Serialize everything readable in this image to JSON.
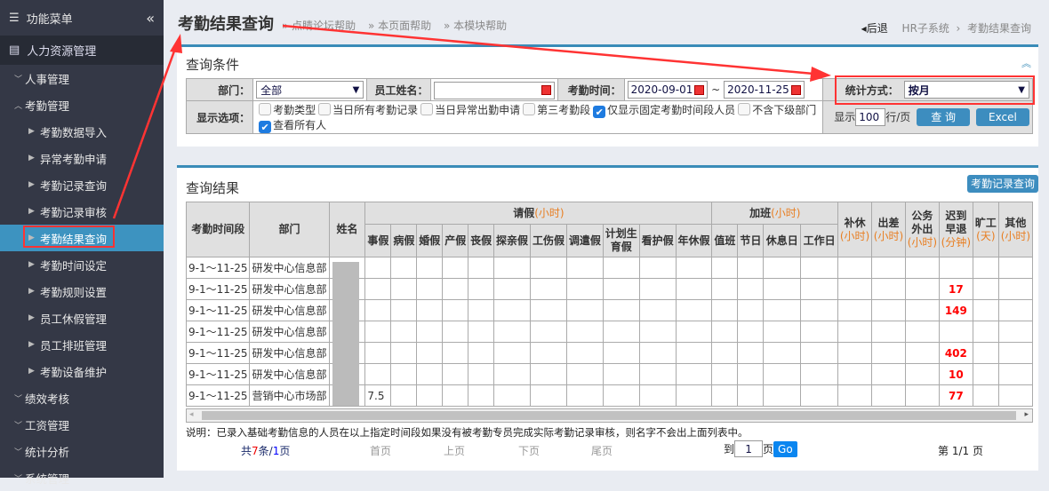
{
  "sidebar": {
    "title": "功能菜单",
    "collapse_icon": "double-chevron-left",
    "module": "人力资源管理",
    "groups": [
      {
        "label": "人事管理"
      },
      {
        "label": "考勤管理"
      }
    ],
    "sub_items": [
      "考勤数据导入",
      "异常考勤申请",
      "考勤记录查询",
      "考勤记录审核",
      "考勤结果查询",
      "考勤时间设定",
      "考勤规则设置",
      "员工休假管理",
      "员工排班管理",
      "考勤设备维护"
    ],
    "active": "考勤结果查询",
    "more_groups": [
      "绩效考核",
      "工资管理",
      "统计分析",
      "系统管理"
    ]
  },
  "header": {
    "title": "考勤结果查询",
    "helps": [
      "» 点睛论坛帮助",
      "» 本页面帮助",
      "» 本模块帮助"
    ],
    "back": "后退",
    "crumbs": [
      "HR子系统",
      "考勤结果查询"
    ]
  },
  "query": {
    "title": "查询条件",
    "dept_label": "部门：",
    "dept_value": "全部",
    "name_label": "员工姓名：",
    "name_value": "",
    "time_label": "考勤时间：",
    "date_from": "2020-09-01",
    "date_sep": "~",
    "date_to": "2020-11-25",
    "stat_label": "统计方式：",
    "stat_value": "按月",
    "options_label": "显示选项：",
    "options": [
      {
        "label": "考勤类型",
        "checked": false
      },
      {
        "label": "当日所有考勤记录",
        "checked": false
      },
      {
        "label": "当日异常出勤申请",
        "checked": false
      },
      {
        "label": "第三考勤段",
        "checked": false
      },
      {
        "label": "仅显示固定考勤时间段人员",
        "checked": true
      },
      {
        "label": "不含下级部门",
        "checked": false
      },
      {
        "label": "查看所有人",
        "checked": true
      }
    ],
    "show_label": "显示",
    "rows_per_page": "100",
    "rows_unit": "行/页",
    "search_btn": "查 询",
    "excel_btn": "Excel"
  },
  "result": {
    "title": "查询结果",
    "record_btn": "考勤记录查询",
    "headers": {
      "period": "考勤时间段",
      "dept": "部门",
      "name": "姓名",
      "leave": "请假",
      "overtime": "加班",
      "unit_hour": "(小时)",
      "leave_cols": [
        "事假",
        "病假",
        "婚假",
        "产假",
        "丧假",
        "探亲假",
        "工伤假",
        "调遣假",
        "计划生育假",
        "看护假",
        "年休假"
      ],
      "ot_cols": [
        "值班",
        "节日",
        "休息日",
        "工作日"
      ],
      "other_cols": [
        {
          "label": "补休",
          "unit": "(小时)"
        },
        {
          "label": "出差",
          "unit": "(小时)"
        },
        {
          "label": "公务外出",
          "unit": "(小时)"
        },
        {
          "label": "迟到早退",
          "unit": "(分钟)"
        },
        {
          "label": "旷工",
          "unit": "(天)"
        },
        {
          "label": "其他",
          "unit": "(小时)"
        }
      ]
    },
    "rows": [
      {
        "period": "9-1～11-25",
        "dept": "研发中心信息部",
        "shijia": "",
        "late": ""
      },
      {
        "period": "9-1～11-25",
        "dept": "研发中心信息部",
        "shijia": "",
        "late": "17"
      },
      {
        "period": "9-1～11-25",
        "dept": "研发中心信息部",
        "shijia": "",
        "late": "149"
      },
      {
        "period": "9-1～11-25",
        "dept": "研发中心信息部",
        "shijia": "",
        "late": ""
      },
      {
        "period": "9-1～11-25",
        "dept": "研发中心信息部",
        "shijia": "",
        "late": "402"
      },
      {
        "period": "9-1～11-25",
        "dept": "研发中心信息部",
        "shijia": "",
        "late": "10"
      },
      {
        "period": "9-1～11-25",
        "dept": "营销中心市场部",
        "shijia": "7.5",
        "late": "77"
      }
    ],
    "note": "说明：已录入基础考勤信息的人员在以上指定时间段如果没有被考勤专员完成实际考勤记录审核，则名字不会出上面列表中。",
    "pager": {
      "total_prefix": "共",
      "total": "7",
      "total_mid": "条/",
      "pages": "1",
      "total_suffix": "页",
      "first": "首页",
      "prev": "上页",
      "next": "下页",
      "last": "尾页",
      "goto_label": "到",
      "goto_value": "1",
      "goto_unit": "页",
      "go": "Go",
      "current": "第 1/1 页"
    }
  },
  "colors": {
    "sidebar": "#343846",
    "active": "#3d93c0",
    "accent": "#3a8cb8",
    "highlight": "#ff3333"
  }
}
